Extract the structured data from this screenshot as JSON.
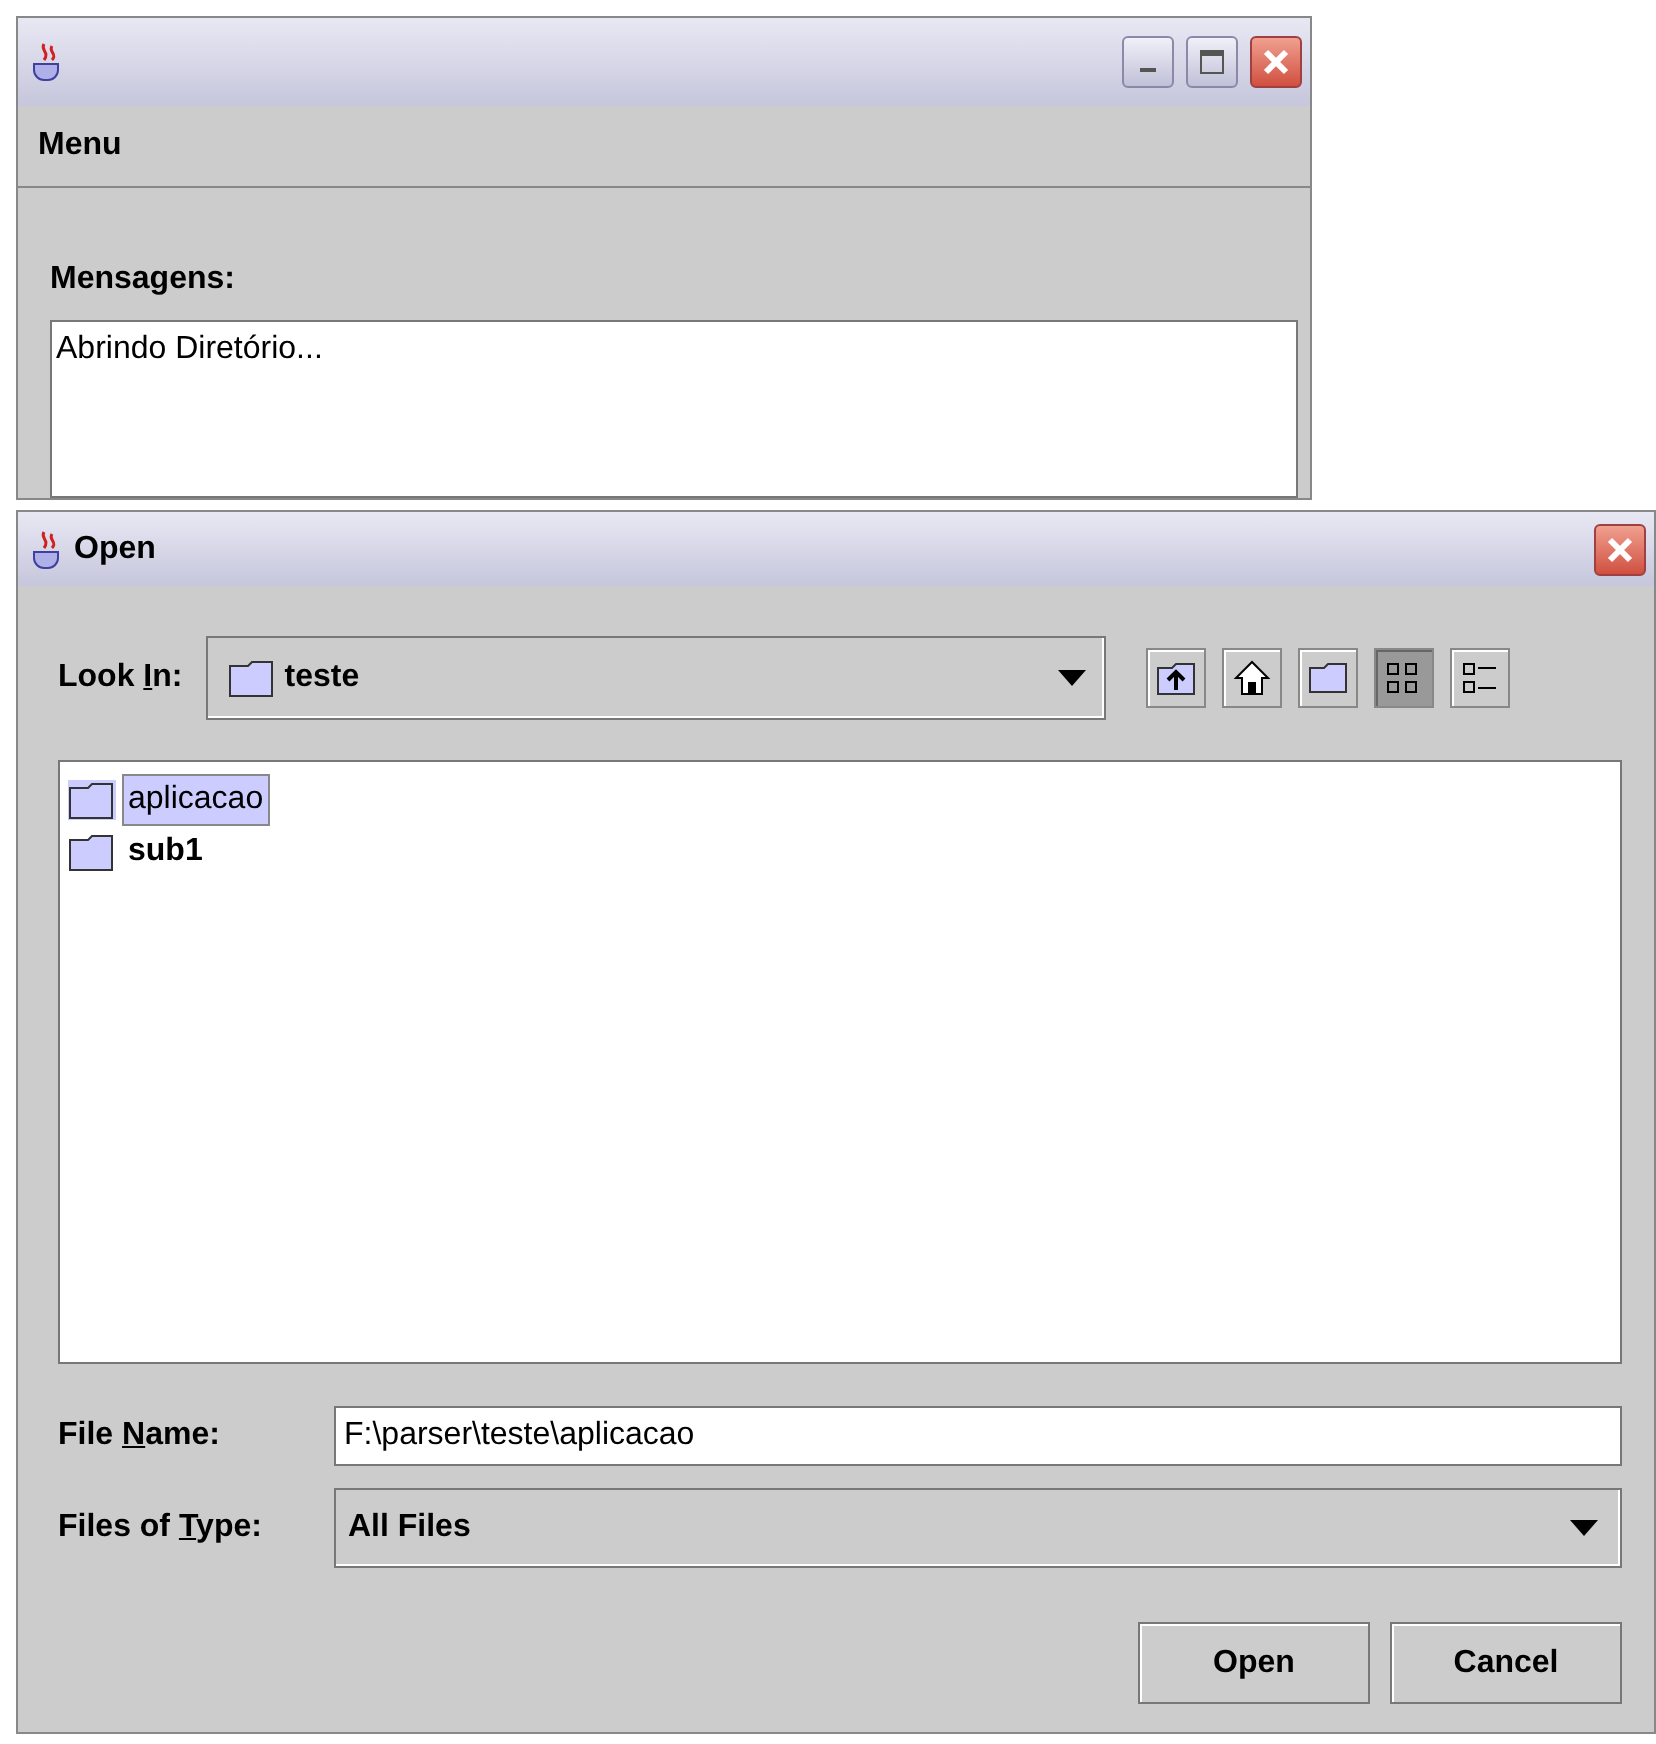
{
  "main_window": {
    "menu_bar": [
      "Menu"
    ],
    "messages_label": "Mensagens:",
    "messages_text": "Abrindo Diretório..."
  },
  "dialog": {
    "title": "Open",
    "look_in": {
      "label_parts": [
        "Look ",
        "I",
        "n:"
      ],
      "value": "teste"
    },
    "toolbar": [
      {
        "kind": "up",
        "selected": false
      },
      {
        "kind": "home",
        "selected": false
      },
      {
        "kind": "newfolder",
        "selected": false
      },
      {
        "kind": "list",
        "selected": true
      },
      {
        "kind": "details",
        "selected": false
      }
    ],
    "files": [
      {
        "name": "aplicacao",
        "selected": true
      },
      {
        "name": "sub1",
        "selected": false
      }
    ],
    "file_name": {
      "label_parts": [
        "File ",
        "N",
        "ame:"
      ],
      "value": "F:\\parser\\teste\\aplicacao"
    },
    "file_type": {
      "label_parts": [
        "Files of ",
        "T",
        "ype:"
      ],
      "value": "All Files"
    },
    "buttons": [
      "Open",
      "Cancel"
    ]
  }
}
